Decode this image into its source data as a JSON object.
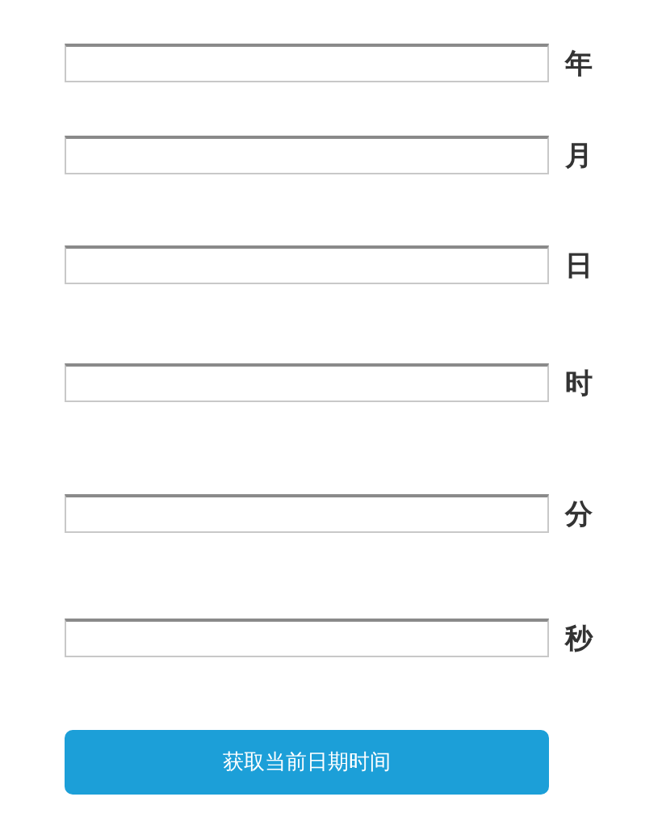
{
  "fields": [
    {
      "label": "年"
    },
    {
      "label": "月"
    },
    {
      "label": "日"
    },
    {
      "label": "时"
    },
    {
      "label": "分"
    },
    {
      "label": "秒"
    }
  ],
  "button": "获取当前日期时间"
}
